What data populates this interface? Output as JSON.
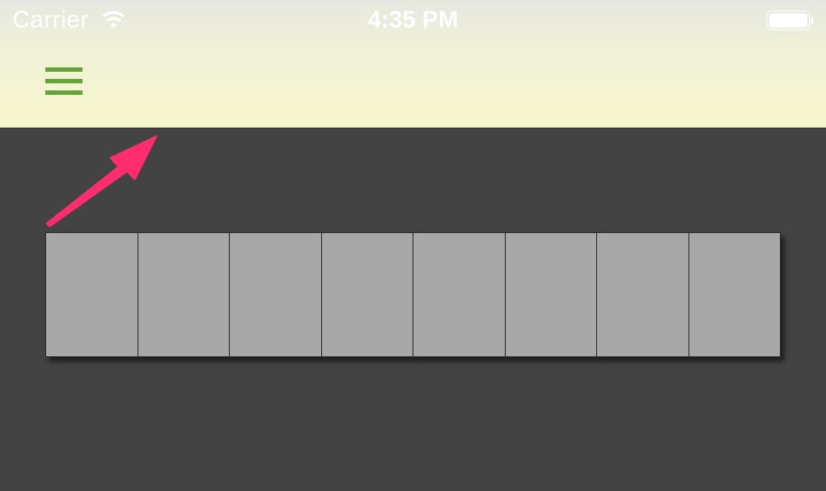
{
  "status_bar": {
    "carrier": "Carrier",
    "time": "4:35 PM",
    "wifi_icon": "wifi-icon",
    "battery_icon": "battery-icon"
  },
  "header": {
    "menu_icon": "hamburger-menu-icon",
    "accent_color": "#65a43a",
    "background_color": "#f6f6cd"
  },
  "annotation": {
    "arrow_icon": "pointer-arrow-icon",
    "color": "#ff2d6f"
  },
  "content": {
    "background_color": "#434343",
    "cell_color": "#a8a8a8",
    "cells": [
      {
        "id": 1
      },
      {
        "id": 2
      },
      {
        "id": 3
      },
      {
        "id": 4
      },
      {
        "id": 5
      },
      {
        "id": 6
      },
      {
        "id": 7
      },
      {
        "id": 8
      }
    ]
  }
}
